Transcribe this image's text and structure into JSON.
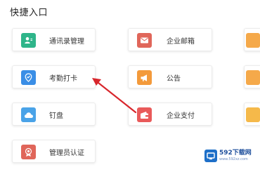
{
  "section": {
    "title": "快捷入口"
  },
  "entries": [
    {
      "label": "通讯录管理",
      "icon": "contacts-icon",
      "color": "#2fb58a"
    },
    {
      "label": "考勤打卡",
      "icon": "location-pin-icon",
      "color": "#3a8ee6"
    },
    {
      "label": "钉盘",
      "icon": "cloud-icon",
      "color": "#4aa3e8"
    },
    {
      "label": "管理员认证",
      "icon": "badge-icon",
      "color": "#e0665a"
    },
    {
      "label": "企业邮箱",
      "icon": "mail-icon",
      "color": "#e0665a"
    },
    {
      "label": "公告",
      "icon": "megaphone-icon",
      "color": "#f39a3b"
    },
    {
      "label": "企业支付",
      "icon": "wallet-icon",
      "color": "#e95a5a"
    }
  ],
  "partial_color": "#f5a94a",
  "annotation": {
    "arrow_color": "#d8262c",
    "target": "考勤打卡"
  },
  "watermark": {
    "text": "592下载网",
    "sub": "www.592xz.com"
  }
}
